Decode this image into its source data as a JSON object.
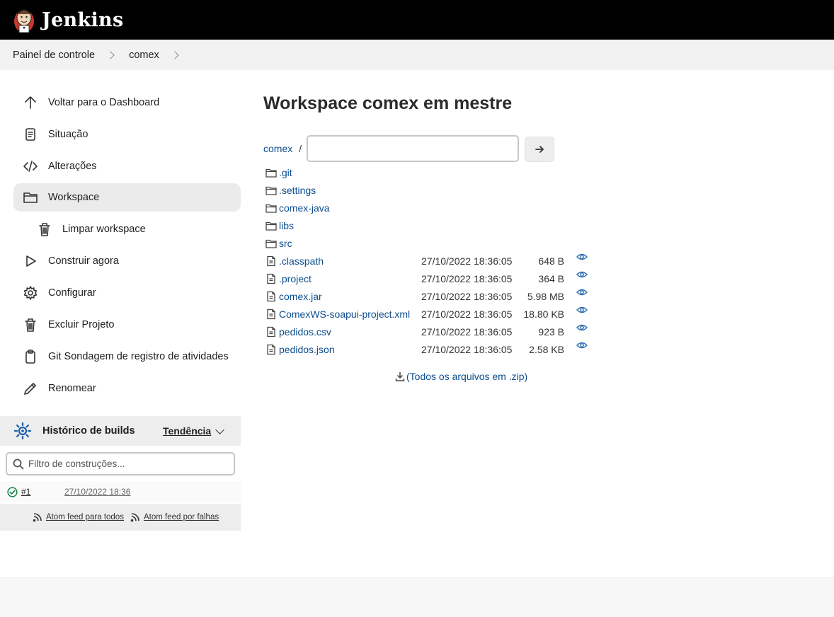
{
  "header": {
    "logo_text": "Jenkins"
  },
  "breadcrumb": {
    "items": [
      "Painel de controle",
      "comex"
    ]
  },
  "sidebar": {
    "tasks": [
      {
        "label": "Voltar para o Dashboard",
        "icon": "arrow-up-icon"
      },
      {
        "label": "Situação",
        "icon": "document-icon"
      },
      {
        "label": "Alterações",
        "icon": "code-icon"
      },
      {
        "label": "Workspace",
        "icon": "folder-icon",
        "active": true
      },
      {
        "label": "Limpar workspace",
        "icon": "trash-icon",
        "sub": true
      },
      {
        "label": "Construir agora",
        "icon": "play-icon"
      },
      {
        "label": "Configurar",
        "icon": "gear-icon"
      },
      {
        "label": "Excluir Projeto",
        "icon": "trash-icon"
      },
      {
        "label": "Git Sondagem de registro de atividades",
        "icon": "clipboard-icon"
      },
      {
        "label": "Renomear",
        "icon": "pencil-icon"
      }
    ]
  },
  "build_history": {
    "title": "Histórico de builds",
    "trend_label": "Tendência",
    "filter_placeholder": "Filtro de construções...",
    "builds": [
      {
        "number": "#1",
        "time": "27/10/2022 18:36",
        "status": "success"
      }
    ],
    "feed_all": "Atom feed para todos",
    "feed_failures": "Atom feed por falhas"
  },
  "main": {
    "title": "Workspace comex em mestre",
    "path_root": "comex",
    "path_sep": "/",
    "path_input_value": "",
    "entries": [
      {
        "name": ".git",
        "type": "folder"
      },
      {
        "name": ".settings",
        "type": "folder"
      },
      {
        "name": "comex-java",
        "type": "folder"
      },
      {
        "name": "libs",
        "type": "folder"
      },
      {
        "name": "src",
        "type": "folder"
      },
      {
        "name": ".classpath",
        "type": "file",
        "date": "27/10/2022 18:36:05",
        "size": "648 B"
      },
      {
        "name": ".project",
        "type": "file",
        "date": "27/10/2022 18:36:05",
        "size": "364 B"
      },
      {
        "name": "comex.jar",
        "type": "file",
        "date": "27/10/2022 18:36:05",
        "size": "5.98 MB"
      },
      {
        "name": "ComexWS-soapui-project.xml",
        "type": "file",
        "date": "27/10/2022 18:36:05",
        "size": "18.80 KB"
      },
      {
        "name": "pedidos.csv",
        "type": "file",
        "date": "27/10/2022 18:36:05",
        "size": "923 B"
      },
      {
        "name": "pedidos.json",
        "type": "file",
        "date": "27/10/2022 18:36:05",
        "size": "2.58 KB"
      }
    ],
    "zip_label": "(Todos os arquivos em .zip)"
  },
  "colors": {
    "header_bg": "#000000",
    "link": "#0b4d8e",
    "success": "#138347",
    "view_icon": "#2f6fb3"
  }
}
